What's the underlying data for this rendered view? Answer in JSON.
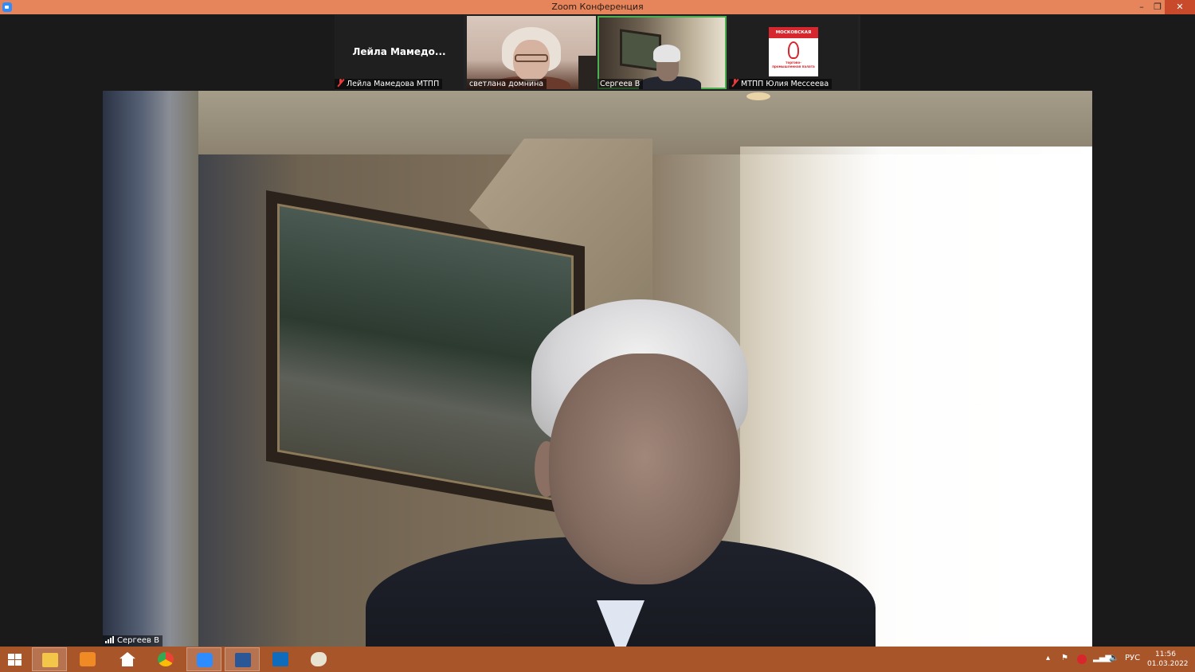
{
  "window": {
    "title": "Zoom Конференция",
    "controls": {
      "minimize": "–",
      "maximize": "❐",
      "close": "✕"
    }
  },
  "gallery": {
    "tiles": [
      {
        "display_name": "Лейла  Мамедо...",
        "label": "Лейла Мамедова МТПП",
        "muted": true,
        "video": false
      },
      {
        "label": "светлана домнина",
        "muted": false,
        "video": true
      },
      {
        "label": "Сергеев В",
        "muted": false,
        "video": true,
        "active_speaker": true
      },
      {
        "label": "МТПП Юлия Мессеева",
        "muted": true,
        "video": false,
        "logo": {
          "top_text": "МОСКОВСКАЯ",
          "bottom_text": "торгово-промышленная палата"
        }
      }
    ]
  },
  "main_video": {
    "speaker_name": "Сергеев В"
  },
  "taskbar": {
    "apps": [
      "windows-start",
      "file-explorer",
      "media-player",
      "home",
      "chrome",
      "zoom",
      "word",
      "outlook",
      "paint"
    ],
    "active_app": "zoom",
    "tray": {
      "language": "РУС",
      "time": "11:56",
      "date": "01.03.2022"
    }
  },
  "colors": {
    "title_bar": "#e6855c",
    "taskbar": "#a8552a",
    "active_speaker_border": "#4caf50",
    "muted_icon": "#e83a3a",
    "background": "#1a1a1a"
  }
}
